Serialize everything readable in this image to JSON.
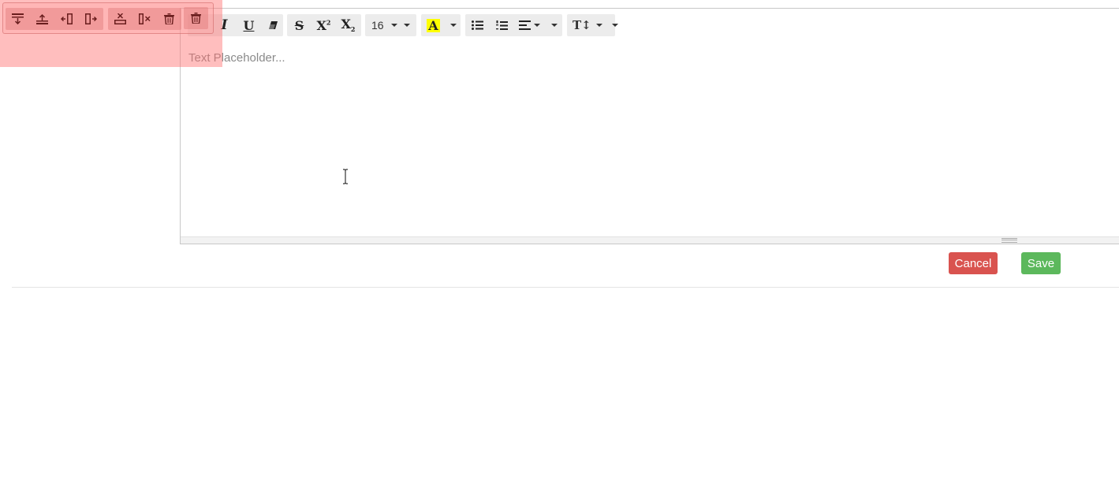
{
  "editor": {
    "placeholder": "Text Placeholder...",
    "font_size": "16",
    "highlight_color": "#ffff00"
  },
  "toolbar": {
    "italic": "I",
    "underline": "U",
    "strike": "S",
    "superscript": "X",
    "subscript": "X",
    "superscript_mark": "2",
    "subscript_mark": "2",
    "color_letter": "A",
    "line_height_label": "T↕"
  },
  "table_popup": {
    "buttons": [
      "add-row-below",
      "add-row-above",
      "add-col-before",
      "add-col-after",
      "delete-row",
      "delete-col",
      "delete-table"
    ],
    "extra_button": "remove-icon"
  },
  "actions": {
    "cancel_label": "Cancel",
    "save_label": "Save"
  },
  "colors": {
    "cancel": "#d9534f",
    "save": "#5cb85c",
    "overlay": "#ff6e6e"
  }
}
